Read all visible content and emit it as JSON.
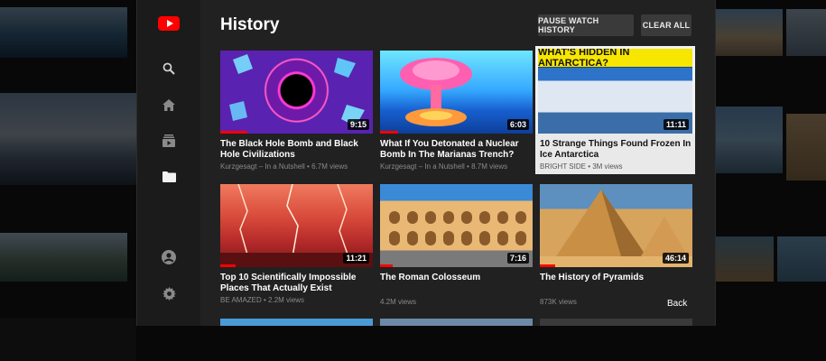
{
  "header": {
    "title": "History",
    "pause_label": "PAUSE WATCH HISTORY",
    "clear_label": "CLEAR ALL"
  },
  "nav": {
    "items": [
      {
        "icon": "youtube-logo-icon"
      },
      {
        "icon": "search-icon"
      },
      {
        "icon": "home-icon"
      },
      {
        "icon": "subscriptions-icon"
      },
      {
        "icon": "library-folder-icon"
      },
      {
        "icon": "account-icon"
      },
      {
        "icon": "settings-gear-icon"
      }
    ]
  },
  "videos": [
    {
      "title": "The Black Hole Bomb and Black Hole Civilizations",
      "meta": "Kurzgesagt – In a Nutshell • 6.7M views",
      "duration": "9:15",
      "progress": 0.18
    },
    {
      "title": "What If You Detonated a Nuclear Bomb In The Marianas Trench?",
      "meta": "Kurzgesagt – In a Nutshell • 8.7M views",
      "duration": "6:03",
      "progress": 0.12
    },
    {
      "title": "10 Strange Things Found Frozen In Ice Antarctica",
      "meta": "BRIGHT SIDE • 3M views",
      "duration": "11:11",
      "progress": 0,
      "overlay": "WHAT'S HIDDEN IN ANTARCTICA?",
      "selected": true
    },
    {
      "title": "Top 10 Scientifically Impossible Places That Actually Exist",
      "meta": "BE AMAZED • 2.2M views",
      "duration": "11:21",
      "progress": 0.1
    },
    {
      "title": "The Roman Colosseum",
      "meta": "4.2M views",
      "duration": "7:16",
      "progress": 0.08
    },
    {
      "title": "The History of Pyramids",
      "meta": "873K views",
      "duration": "46:14",
      "progress": 0.1
    }
  ],
  "footer": {
    "back_label": "Back"
  },
  "colors": {
    "accent": "#ff0000",
    "panel": "#212121",
    "rail": "#1b1b1b"
  }
}
